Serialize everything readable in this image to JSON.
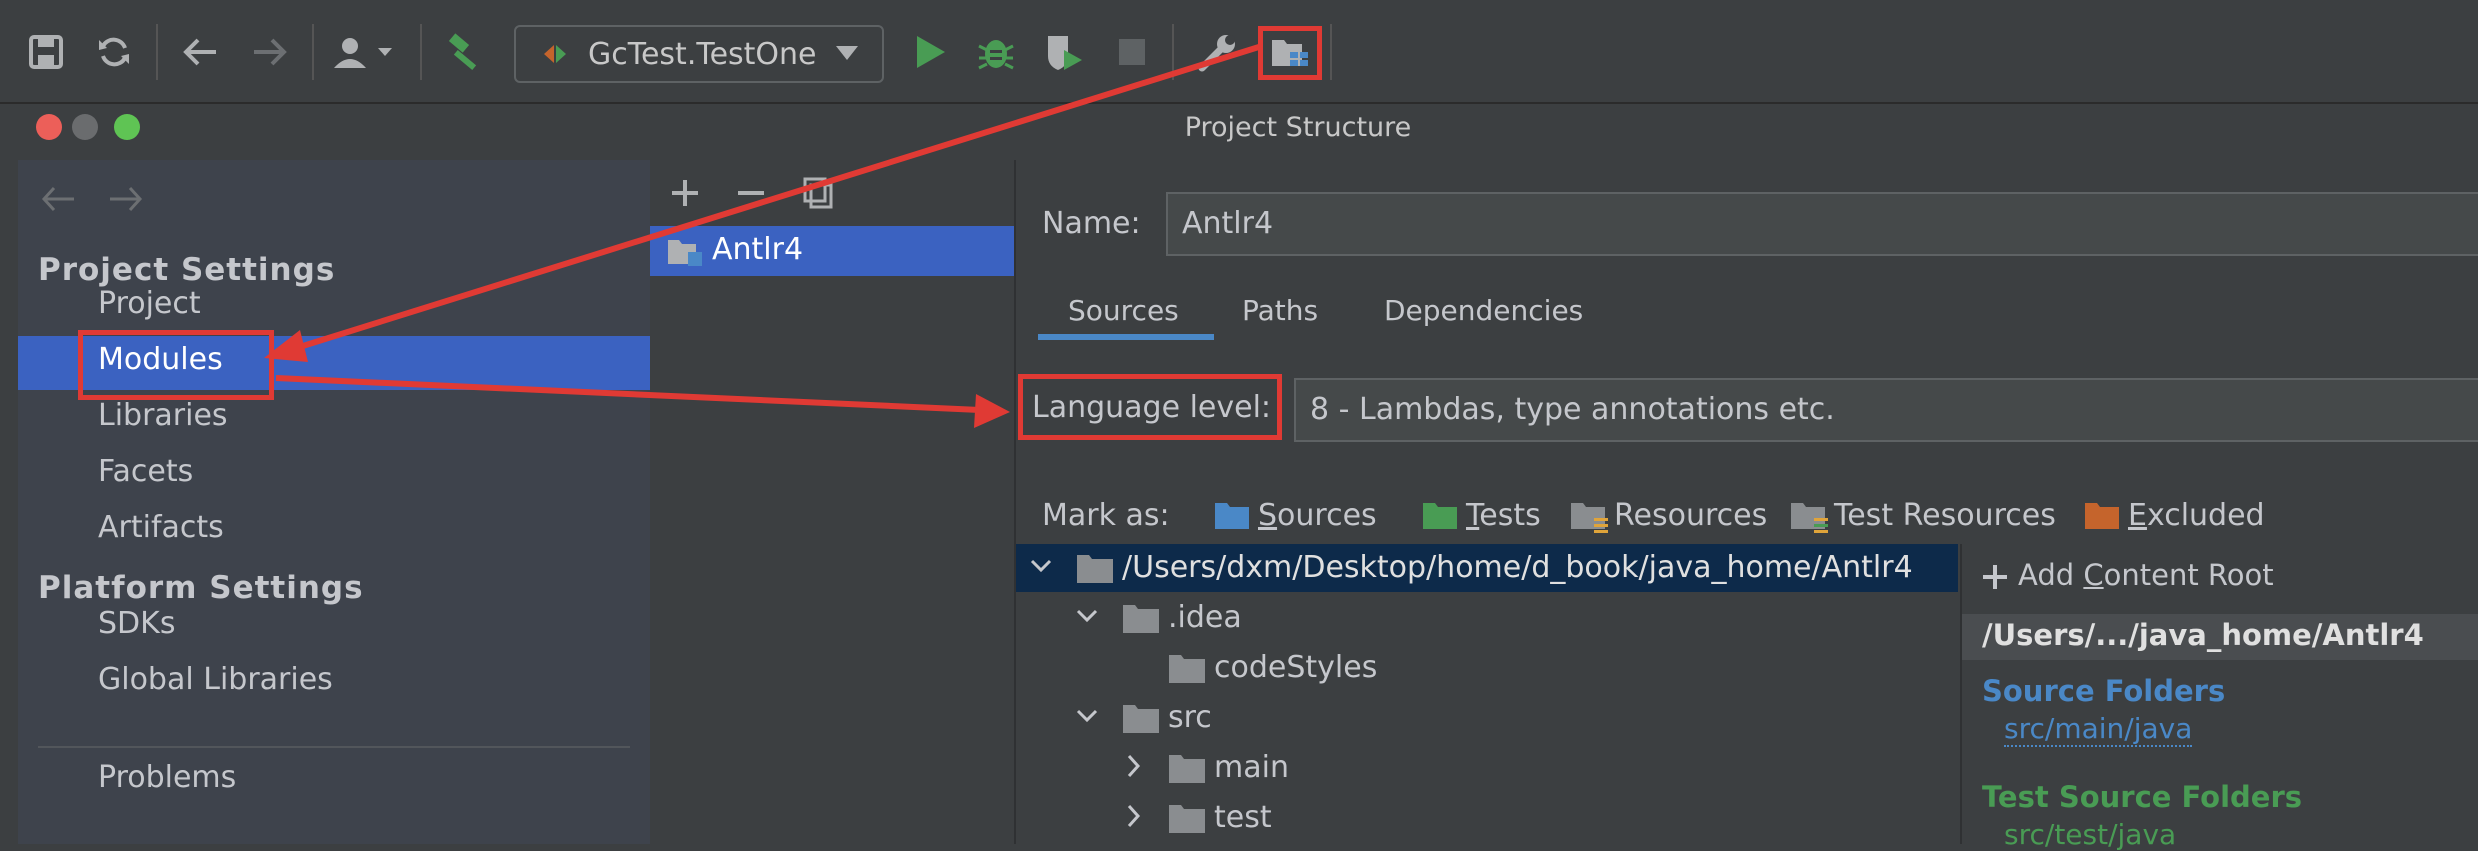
{
  "toolbar": {
    "run_config_label": "GcTest.TestOne",
    "icons": [
      "save-icon",
      "sync-icon",
      "back-icon",
      "forward-icon",
      "user-icon",
      "build-hammer-icon",
      "run-icon",
      "debug-icon",
      "coverage-icon",
      "stop-icon",
      "wrench-icon",
      "project-structure-icon"
    ]
  },
  "dialog": {
    "title": "Project Structure"
  },
  "leftnav": {
    "project_settings_heading": "Project Settings",
    "project_settings_items": [
      "Project",
      "Modules",
      "Libraries",
      "Facets",
      "Artifacts"
    ],
    "platform_settings_heading": "Platform Settings",
    "platform_settings_items": [
      "SDKs",
      "Global Libraries"
    ],
    "problems_label": "Problems",
    "selected": "Modules"
  },
  "modules": {
    "items": [
      "Antlr4"
    ]
  },
  "module_detail": {
    "name_label": "Name:",
    "name_value": "Antlr4",
    "tabs": [
      "Sources",
      "Paths",
      "Dependencies"
    ],
    "active_tab": "Sources",
    "language_level_label": "Language level:",
    "language_level_value": "8 - Lambdas, type annotations etc.",
    "mark_as_label": "Mark as:",
    "mark_as": {
      "sources_rest": "ources",
      "tests_rest": "ests",
      "resources": "Resources",
      "test_resources": "Test Resources",
      "excluded_rest": "xcluded"
    },
    "tree": {
      "root": "/Users/dxm/Desktop/home/d_book/java_home/Antlr4",
      "idea": ".idea",
      "codestyles": "codeStyles",
      "src": "src",
      "main": "main",
      "test": "test"
    },
    "content_roots": {
      "add_label_pre": "Add ",
      "add_label_mid": "ontent Root",
      "path": "/Users/.../java_home/Antlr4",
      "source_folders_heading": "Source Folders",
      "source_folder": "src/main/java",
      "test_source_folders_heading": "Test Source Folders",
      "test_source_folder": "src/test/java"
    }
  },
  "colors": {
    "accent_selection": "#3b62c1",
    "annotation_red": "#e03a34",
    "sources_blue": "#4a88c7",
    "tests_green": "#499c54",
    "excluded_orange": "#c5642c"
  }
}
